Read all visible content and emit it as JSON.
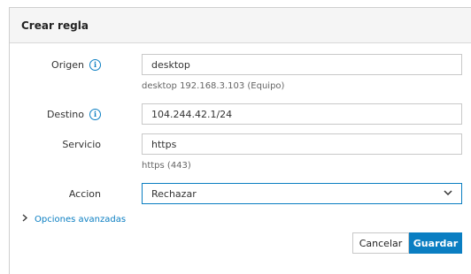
{
  "dialog": {
    "title": "Crear regla"
  },
  "form": {
    "origin": {
      "label": "Origen",
      "value": "desktop",
      "helper": "desktop 192.168.3.103 (Equipo)"
    },
    "destination": {
      "label": "Destino",
      "value": "104.244.42.1/24"
    },
    "service": {
      "label": "Servicio",
      "value": "https",
      "helper": "https (443)"
    },
    "action": {
      "label": "Accion",
      "selected": "Rechazar"
    }
  },
  "advanced": {
    "label": "Opciones avanzadas"
  },
  "buttons": {
    "cancel": "Cancelar",
    "save": "Guardar"
  },
  "colors": {
    "accent": "#0a7ec2",
    "header_bg": "#f5f5f5"
  },
  "icons": {
    "info": "info-circle-icon",
    "select_chevron": "chevron-down-icon",
    "expand": "chevron-right-icon"
  }
}
